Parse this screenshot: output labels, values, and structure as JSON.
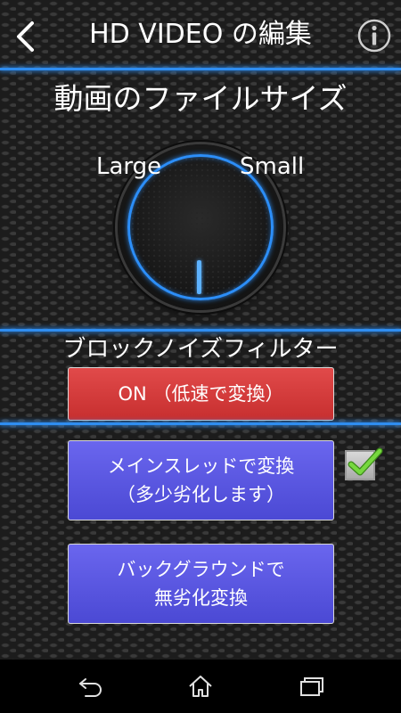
{
  "header": {
    "title": "HD VIDEO の編集",
    "back_icon": "chevron-left-icon",
    "info_icon": "info-icon"
  },
  "file_size": {
    "title": "動画のファイルサイズ",
    "label_large": "Large",
    "label_small": "Small",
    "dial_position": 0.5
  },
  "block_noise": {
    "title": "ブロックノイズフィルター",
    "on_button_label": "ON （低速で変換）"
  },
  "main_thread": {
    "button_line1": "メインスレッドで変換",
    "button_line2": "（多少劣化します）",
    "checked": true
  },
  "background": {
    "button_line1": "バックグラウンドで",
    "button_line2": "無劣化変換"
  },
  "navbar": {
    "back_icon": "nav-back-icon",
    "home_icon": "nav-home-icon",
    "recent_icon": "nav-recent-apps-icon"
  },
  "colors": {
    "accent_blue": "#2f8df0",
    "on_button_red": "#d83a3a",
    "button_blue": "#5a57e0",
    "check_green": "#6fd23a"
  }
}
